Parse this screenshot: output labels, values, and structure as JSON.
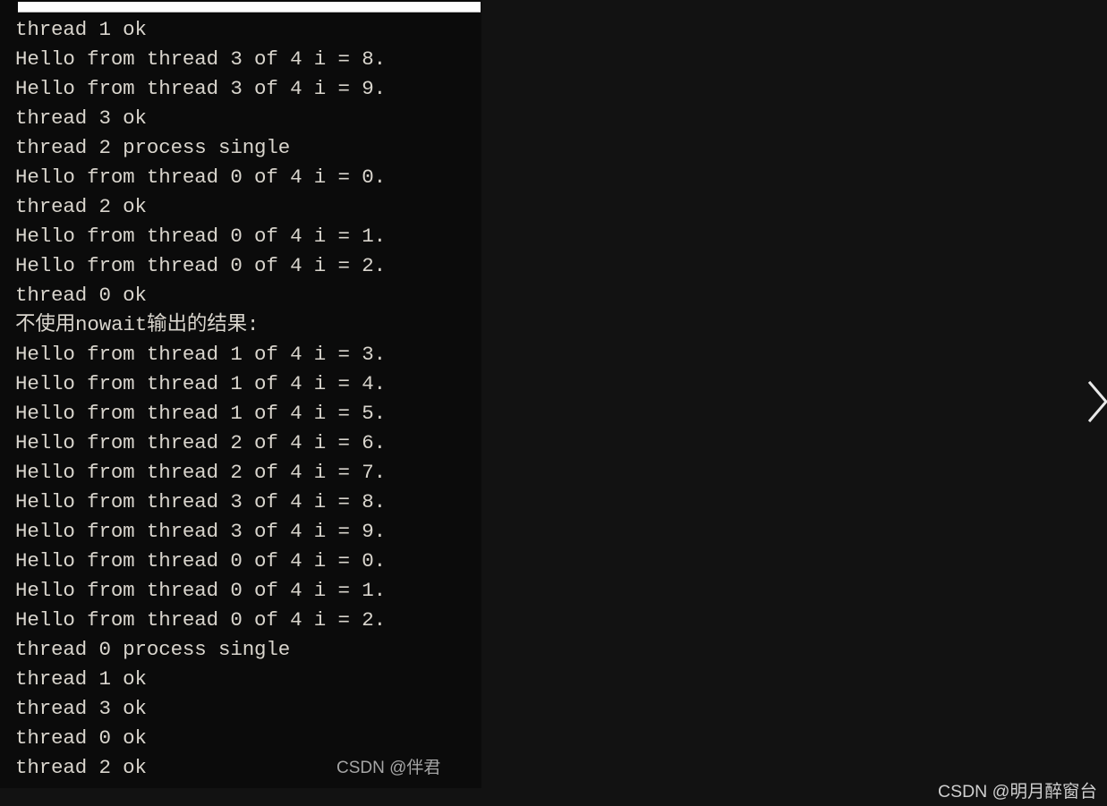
{
  "page": {
    "background_color": "#121212"
  },
  "console": {
    "panel_name": "program-output-console",
    "background_color": "#0b0b0b",
    "text_color": "#d9d5cd",
    "top_strip_color": "#ffffff",
    "lines": [
      "thread 1 ok",
      "Hello from thread 3 of 4 i = 8.",
      "Hello from thread 3 of 4 i = 9.",
      "thread 3 ok",
      "thread 2 process single",
      "Hello from thread 0 of 4 i = 0.",
      "thread 2 ok",
      "Hello from thread 0 of 4 i = 1.",
      "Hello from thread 0 of 4 i = 2.",
      "thread 0 ok",
      "不使用nowait输出的结果:",
      "Hello from thread 1 of 4 i = 3.",
      "Hello from thread 1 of 4 i = 4.",
      "Hello from thread 1 of 4 i = 5.",
      "Hello from thread 2 of 4 i = 6.",
      "Hello from thread 2 of 4 i = 7.",
      "Hello from thread 3 of 4 i = 8.",
      "Hello from thread 3 of 4 i = 9.",
      "Hello from thread 0 of 4 i = 0.",
      "Hello from thread 0 of 4 i = 1.",
      "Hello from thread 0 of 4 i = 2.",
      "thread 0 process single",
      "thread 1 ok",
      "thread 3 ok",
      "thread 0 ok",
      "thread 2 ok"
    ]
  },
  "watermarks": {
    "inner": "CSDN @伴君",
    "outer": "CSDN @明月醉窗台"
  },
  "icons": {
    "next_chevron": "chevron-right-icon"
  }
}
